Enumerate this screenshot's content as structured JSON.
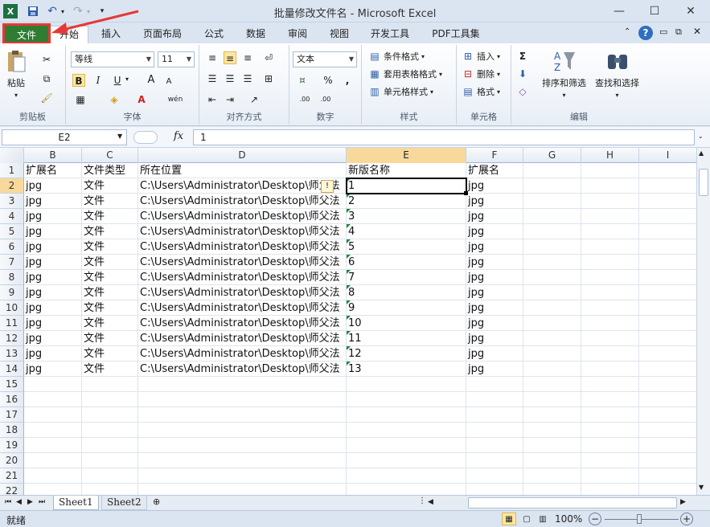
{
  "window": {
    "title": "批量修改文件名 - Microsoft Excel",
    "minimize": "—",
    "maximize": "☐",
    "close": "✕"
  },
  "tabs": {
    "file": "文件",
    "items": [
      "开始",
      "插入",
      "页面布局",
      "公式",
      "数据",
      "审阅",
      "视图",
      "开发工具",
      "PDF工具集"
    ]
  },
  "ribbon": {
    "clipboard": {
      "label": "剪贴板",
      "paste": "粘贴"
    },
    "font": {
      "label": "字体",
      "name": "等线",
      "size": "11",
      "bold": "B",
      "italic": "I",
      "underline": "U",
      "grow": "A",
      "shrink": "A",
      "phonetic": "wén"
    },
    "alignment": {
      "label": "对齐方式"
    },
    "number": {
      "label": "数字",
      "format": "文本",
      "percent": "%",
      "comma": ",",
      "inc_decimal": ".00",
      "dec_decimal": ".00"
    },
    "styles": {
      "label": "样式",
      "conditional": "条件格式",
      "table": "套用表格格式",
      "cell": "单元格样式"
    },
    "cells": {
      "label": "单元格",
      "insert": "插入",
      "delete": "删除",
      "format": "格式"
    },
    "editing": {
      "label": "编辑",
      "sum": "Σ",
      "sort": "排序和筛选",
      "find": "查找和选择"
    }
  },
  "formula_bar": {
    "name_box": "E2",
    "fx": "fx",
    "value": "1"
  },
  "columns": [
    "B",
    "C",
    "D",
    "E",
    "F",
    "G",
    "H",
    "I"
  ],
  "rows": [
    "1",
    "2",
    "3",
    "4",
    "5",
    "6",
    "7",
    "8",
    "9",
    "10",
    "11",
    "12",
    "13",
    "14",
    "15",
    "16",
    "17",
    "18",
    "19",
    "20",
    "21",
    "22"
  ],
  "table": {
    "headers": [
      "扩展名",
      "文件类型",
      "所在位置",
      "新版名称",
      "扩展名"
    ],
    "data": [
      [
        "jpg",
        "文件",
        "C:\\Users\\Administrator\\Desktop\\师父法",
        "1",
        "jpg"
      ],
      [
        "jpg",
        "文件",
        "C:\\Users\\Administrator\\Desktop\\师父法",
        "2",
        "jpg"
      ],
      [
        "jpg",
        "文件",
        "C:\\Users\\Administrator\\Desktop\\师父法",
        "3",
        "jpg"
      ],
      [
        "jpg",
        "文件",
        "C:\\Users\\Administrator\\Desktop\\师父法",
        "4",
        "jpg"
      ],
      [
        "jpg",
        "文件",
        "C:\\Users\\Administrator\\Desktop\\师父法",
        "5",
        "jpg"
      ],
      [
        "jpg",
        "文件",
        "C:\\Users\\Administrator\\Desktop\\师父法",
        "6",
        "jpg"
      ],
      [
        "jpg",
        "文件",
        "C:\\Users\\Administrator\\Desktop\\师父法",
        "7",
        "jpg"
      ],
      [
        "jpg",
        "文件",
        "C:\\Users\\Administrator\\Desktop\\师父法",
        "8",
        "jpg"
      ],
      [
        "jpg",
        "文件",
        "C:\\Users\\Administrator\\Desktop\\师父法",
        "9",
        "jpg"
      ],
      [
        "jpg",
        "文件",
        "C:\\Users\\Administrator\\Desktop\\师父法",
        "10",
        "jpg"
      ],
      [
        "jpg",
        "文件",
        "C:\\Users\\Administrator\\Desktop\\师父法",
        "11",
        "jpg"
      ],
      [
        "jpg",
        "文件",
        "C:\\Users\\Administrator\\Desktop\\师父法",
        "12",
        "jpg"
      ],
      [
        "jpg",
        "文件",
        "C:\\Users\\Administrator\\Desktop\\师父法",
        "13",
        "jpg"
      ]
    ]
  },
  "sheets": [
    "Sheet1",
    "Sheet2"
  ],
  "status": {
    "ready": "就绪",
    "zoom": "100%"
  },
  "colors": {
    "file_tab": "#2e7d32",
    "annotation": "#e53935",
    "selected_header": "#f9d99b"
  }
}
